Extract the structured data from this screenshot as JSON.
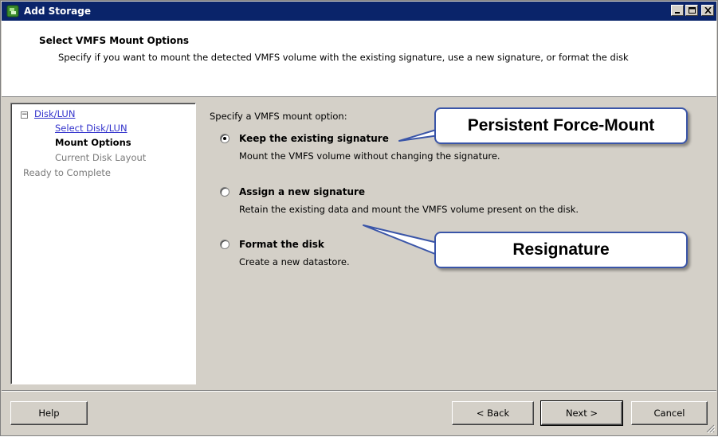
{
  "window": {
    "title": "Add Storage",
    "icon": "storage-wizard-icon",
    "controls": [
      "minimize",
      "maximize",
      "close"
    ]
  },
  "header": {
    "title": "Select VMFS Mount Options",
    "description": "Specify if you want to mount the detected VMFS volume with the existing signature, use a new signature, or format the disk"
  },
  "nav": {
    "root": "Disk/LUN",
    "items": [
      {
        "label": "Select Disk/LUN",
        "state": "link"
      },
      {
        "label": "Mount Options",
        "state": "active"
      },
      {
        "label": "Current Disk Layout",
        "state": "disabled"
      }
    ],
    "ready": "Ready to Complete"
  },
  "main": {
    "prompt": "Specify a VMFS mount option:",
    "options": [
      {
        "label": "Keep the existing signature",
        "description": "Mount the VMFS volume without changing the signature.",
        "checked": true
      },
      {
        "label": "Assign a new signature",
        "description": "Retain the existing data and mount the VMFS volume present on the disk.",
        "checked": false
      },
      {
        "label": "Format the disk",
        "description": "Create a new datastore.",
        "checked": false
      }
    ]
  },
  "callouts": {
    "top": "Persistent Force-Mount",
    "bottom": "Resignature"
  },
  "buttons": {
    "help": "Help",
    "back": "< Back",
    "next": "Next >",
    "cancel": "Cancel"
  },
  "colors": {
    "titlebar": "#0a246a",
    "dialog": "#d4d0c8",
    "link": "#3333cc",
    "callout_border": "#3a55a8"
  }
}
